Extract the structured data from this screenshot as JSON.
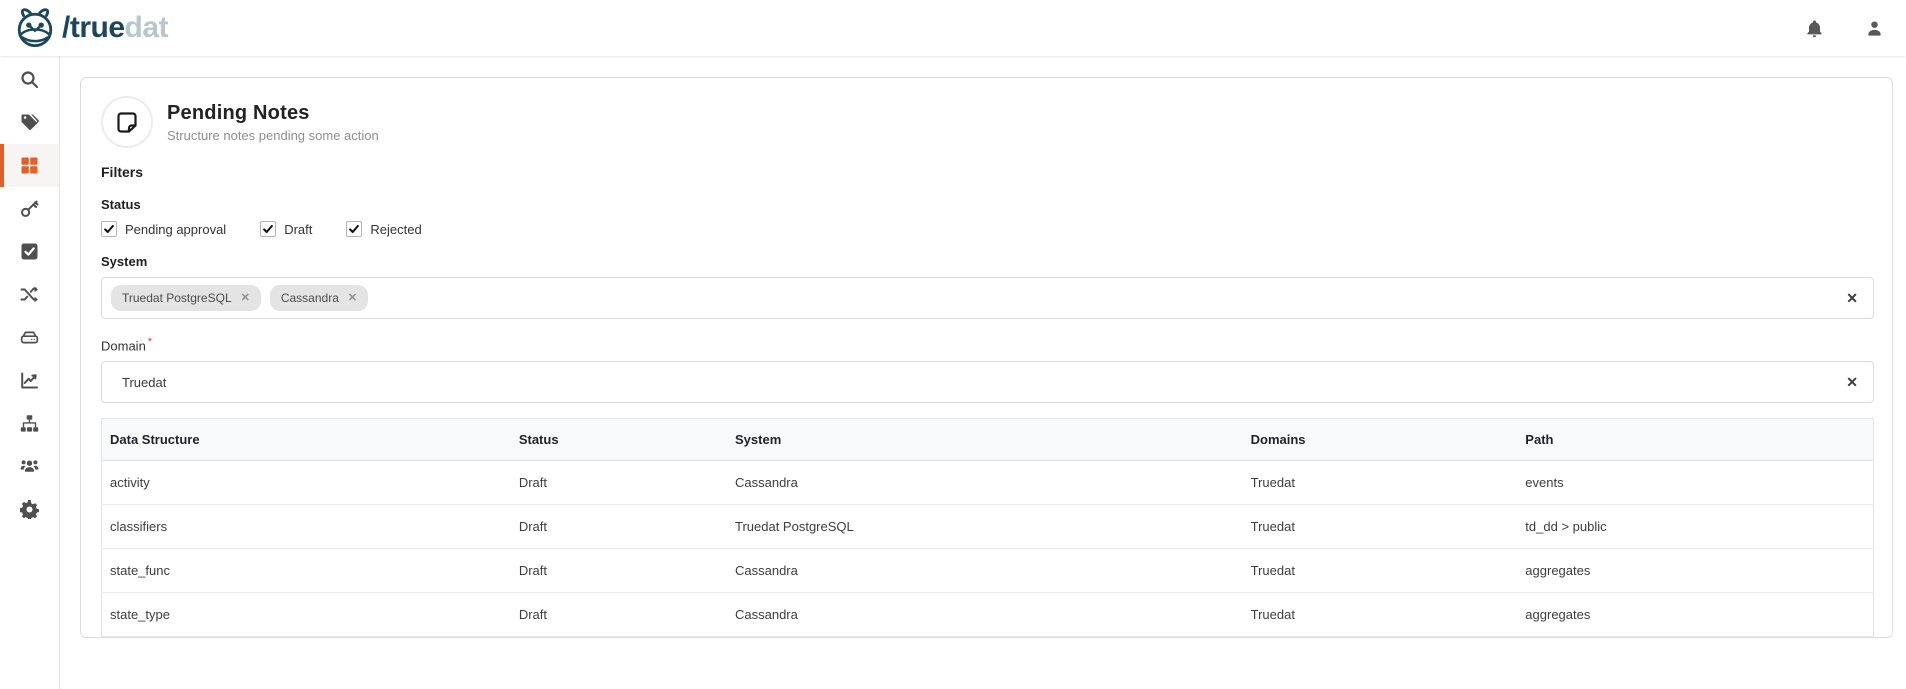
{
  "brand": {
    "logo_icon": "owl-icon",
    "wordmark_primary": "/true",
    "wordmark_secondary": "dat"
  },
  "topbar": {
    "icons": [
      "bell-icon",
      "user-icon"
    ]
  },
  "sidebar": {
    "items": [
      {
        "id": "search",
        "icon": "search-icon",
        "active": false
      },
      {
        "id": "tags",
        "icon": "tags-icon",
        "active": false
      },
      {
        "id": "dashboard",
        "icon": "grid-icon",
        "active": true
      },
      {
        "id": "key",
        "icon": "key-icon",
        "active": false
      },
      {
        "id": "quality",
        "icon": "check-square-icon",
        "active": false
      },
      {
        "id": "lineage",
        "icon": "shuffle-icon",
        "active": false
      },
      {
        "id": "systems",
        "icon": "hdd-icon",
        "active": false
      },
      {
        "id": "charts",
        "icon": "chart-line-icon",
        "active": false
      },
      {
        "id": "taxonomy",
        "icon": "sitemap-icon",
        "active": false
      },
      {
        "id": "users",
        "icon": "users-icon",
        "active": false
      },
      {
        "id": "settings",
        "icon": "gear-icon",
        "active": false
      }
    ]
  },
  "page": {
    "title": "Pending Notes",
    "subtitle": "Structure notes pending some action",
    "header_icon": "note-icon",
    "filters": {
      "heading": "Filters",
      "status": {
        "label": "Status",
        "options": [
          {
            "label": "Pending approval",
            "checked": true
          },
          {
            "label": "Draft",
            "checked": true
          },
          {
            "label": "Rejected",
            "checked": true
          }
        ]
      },
      "system": {
        "label": "System",
        "tags": [
          "Truedat PostgreSQL",
          "Cassandra"
        ],
        "clear_icon": "clear-x-icon"
      },
      "domain": {
        "label": "Domain",
        "required_mark": "*",
        "value": "Truedat",
        "clear_icon": "clear-x-icon"
      }
    },
    "table": {
      "columns": [
        "Data Structure",
        "Status",
        "System",
        "Domains",
        "Path"
      ],
      "column_widths": [
        "23.1%",
        "12.2%",
        "29.1%",
        "15.5%",
        "20.1%"
      ],
      "rows": [
        [
          "activity",
          "Draft",
          "Cassandra",
          "Truedat",
          "events"
        ],
        [
          "classifiers",
          "Draft",
          "Truedat PostgreSQL",
          "Truedat",
          "td_dd > public"
        ],
        [
          "state_func",
          "Draft",
          "Cassandra",
          "Truedat",
          "aggregates"
        ],
        [
          "state_type",
          "Draft",
          "Cassandra",
          "Truedat",
          "aggregates"
        ]
      ]
    }
  },
  "colors": {
    "accent_orange": "#e25f2a",
    "logo_navy": "#1c465c",
    "logo_light_blue": "#b9c6ce",
    "required_mark": "#d6336c",
    "sidebar_icon_gray": "#4f4f4f"
  }
}
